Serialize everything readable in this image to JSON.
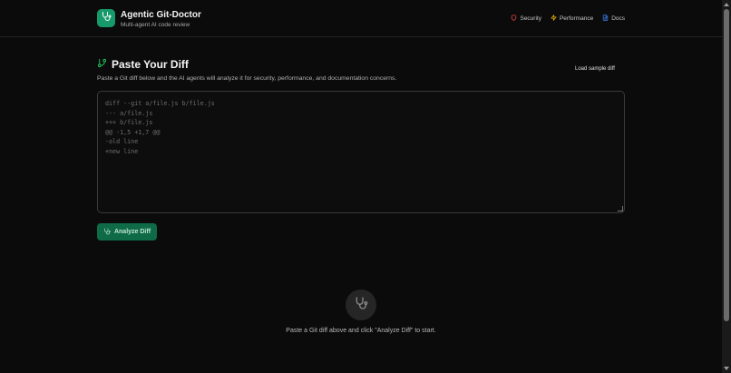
{
  "app": {
    "title": "Agentic Git-Doctor",
    "subtitle": "Multi-agent AI code review",
    "logo_icon": "stethoscope-icon",
    "brand_color": "#169a6b"
  },
  "nav": {
    "items": [
      {
        "label": "Security",
        "icon": "shield-icon",
        "color": "#ef4444"
      },
      {
        "label": "Performance",
        "icon": "zap-icon",
        "color": "#eab308"
      },
      {
        "label": "Docs",
        "icon": "file-text-icon",
        "color": "#3b82f6"
      }
    ]
  },
  "main": {
    "title": "Paste Your Diff",
    "title_icon": "git-branch-icon",
    "description": "Paste a Git diff below and the AI agents will analyze it for security, performance, and documentation concerns.",
    "load_sample_label": "Load sample diff",
    "diff_placeholder": "diff --git a/file.js b/file.js\n--- a/file.js\n+++ b/file.js\n@@ -1,5 +1,7 @@\n-old line\n+new line",
    "analyze_label": "Analyze Diff",
    "analyze_icon": "stethoscope-icon"
  },
  "empty_state": {
    "icon": "stethoscope-icon",
    "message": "Paste a Git diff above and click \"Analyze Diff\" to start."
  }
}
